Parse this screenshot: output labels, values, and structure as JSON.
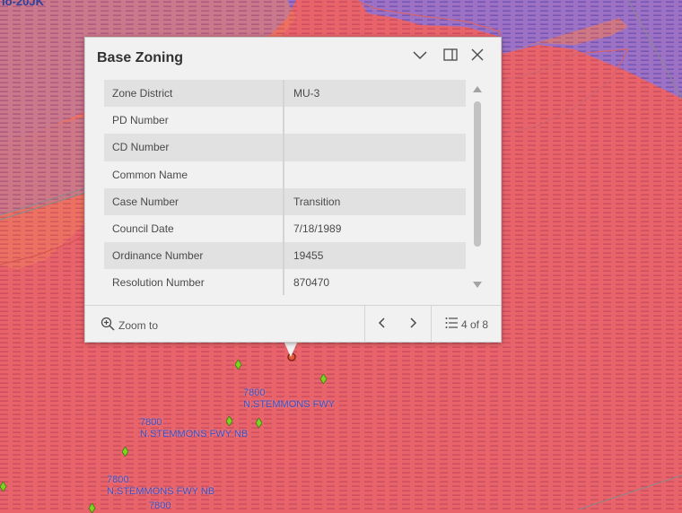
{
  "map": {
    "corner_label": "lo-20JK",
    "colors": {
      "base": "#e8646a",
      "purple": "#9a70c0",
      "stripe": "#c94f7a",
      "marker": "#7ed321"
    },
    "labels": [
      {
        "number": "7800",
        "street": "N.STEMMONS FWY"
      },
      {
        "number": "7800",
        "street": "N.STEMMONS FWY NB"
      },
      {
        "number": "7800",
        "street": "N.STEMMONS FWY NB"
      },
      {
        "number": "7800",
        "street": ""
      }
    ]
  },
  "popup": {
    "title": "Base Zoning",
    "collapse_icon": "chevron-down-icon",
    "dock_icon": "dock-icon",
    "close_icon": "close-icon",
    "rows": [
      {
        "label": "Zone District",
        "value": "MU-3"
      },
      {
        "label": "PD Number",
        "value": ""
      },
      {
        "label": "CD Number",
        "value": ""
      },
      {
        "label": "Common Name",
        "value": ""
      },
      {
        "label": "Case Number",
        "value": "Transition"
      },
      {
        "label": "Council Date",
        "value": "7/18/1989"
      },
      {
        "label": "Ordinance Number",
        "value": "19455"
      },
      {
        "label": "Resolution Number",
        "value": "870470"
      }
    ],
    "footer": {
      "zoom_label": "Zoom to",
      "count_label": "4 of 8"
    }
  }
}
